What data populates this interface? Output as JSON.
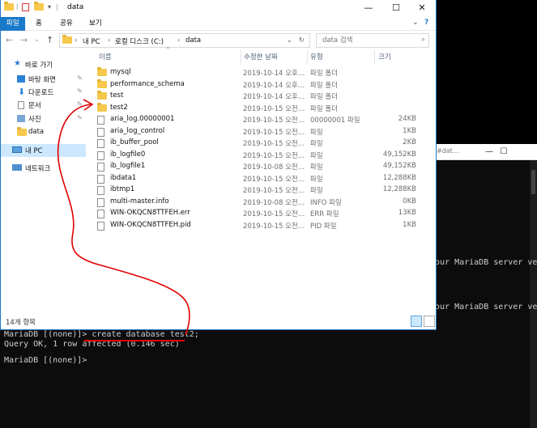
{
  "console": {
    "title_fragment": "#dat…",
    "side_text_1": "our MariaDB server ve",
    "side_text_2": "our MariaDB server ve",
    "lines": [
      "MariaDB [(none)]> create database test2;",
      "Query OK, 1 row affected (0.146 sec)",
      "",
      "MariaDB [(none)]>"
    ]
  },
  "explorer": {
    "title": "data",
    "ribbon_tabs": [
      "파일",
      "홈",
      "공유",
      "보기"
    ],
    "breadcrumb": [
      "내 PC",
      "로컬 디스크 (C:)",
      "data"
    ],
    "search_placeholder": "data 검색",
    "nav_items": [
      {
        "label": "바로 가기",
        "icon": "star-icon"
      },
      {
        "label": "바탕 화면",
        "icon": "desktop-icon"
      },
      {
        "label": "다운로드",
        "icon": "download-icon"
      },
      {
        "label": "문서",
        "icon": "document-icon"
      },
      {
        "label": "사진",
        "icon": "pictures-icon"
      },
      {
        "label": "data",
        "icon": "folder-icon"
      },
      {
        "label": "내 PC",
        "icon": "computer-icon"
      },
      {
        "label": "네트워크",
        "icon": "network-icon"
      }
    ],
    "columns": [
      "이름",
      "수정한 날짜",
      "유형",
      "크기"
    ],
    "files": [
      {
        "name": "mysql",
        "date": "2019-10-14 오후…",
        "type": "파일 폴더",
        "size": "",
        "folder": true
      },
      {
        "name": "performance_schema",
        "date": "2019-10-14 오후…",
        "type": "파일 폴더",
        "size": "",
        "folder": true
      },
      {
        "name": "test",
        "date": "2019-10-14 오후…",
        "type": "파일 폴더",
        "size": "",
        "folder": true
      },
      {
        "name": "test2",
        "date": "2019-10-15 오전…",
        "type": "파일 폴더",
        "size": "",
        "folder": true
      },
      {
        "name": "aria_log.00000001",
        "date": "2019-10-15 오전…",
        "type": "00000001 파일",
        "size": "24KB",
        "folder": false
      },
      {
        "name": "aria_log_control",
        "date": "2019-10-15 오전…",
        "type": "파일",
        "size": "1KB",
        "folder": false
      },
      {
        "name": "ib_buffer_pool",
        "date": "2019-10-15 오전…",
        "type": "파일",
        "size": "2KB",
        "folder": false
      },
      {
        "name": "ib_logfile0",
        "date": "2019-10-15 오전…",
        "type": "파일",
        "size": "49,152KB",
        "folder": false
      },
      {
        "name": "ib_logfile1",
        "date": "2019-10-08 오전…",
        "type": "파일",
        "size": "49,152KB",
        "folder": false
      },
      {
        "name": "ibdata1",
        "date": "2019-10-15 오전…",
        "type": "파일",
        "size": "12,288KB",
        "folder": false
      },
      {
        "name": "ibtmp1",
        "date": "2019-10-15 오전…",
        "type": "파일",
        "size": "12,288KB",
        "folder": false
      },
      {
        "name": "multi-master.info",
        "date": "2019-10-08 오전…",
        "type": "INFO 파일",
        "size": "0KB",
        "folder": false
      },
      {
        "name": "WIN-OKQCN8TTFEH.err",
        "date": "2019-10-15 오전…",
        "type": "ERR 파일",
        "size": "13KB",
        "folder": false
      },
      {
        "name": "WIN-OKQCN8TTFEH.pid",
        "date": "2019-10-15 오전…",
        "type": "PID 파일",
        "size": "1KB",
        "folder": false
      }
    ],
    "status_count": "14개 항목"
  },
  "colors": {
    "accent": "#1979ca",
    "annotation": "#e10000",
    "folder": "#f6c84b"
  }
}
